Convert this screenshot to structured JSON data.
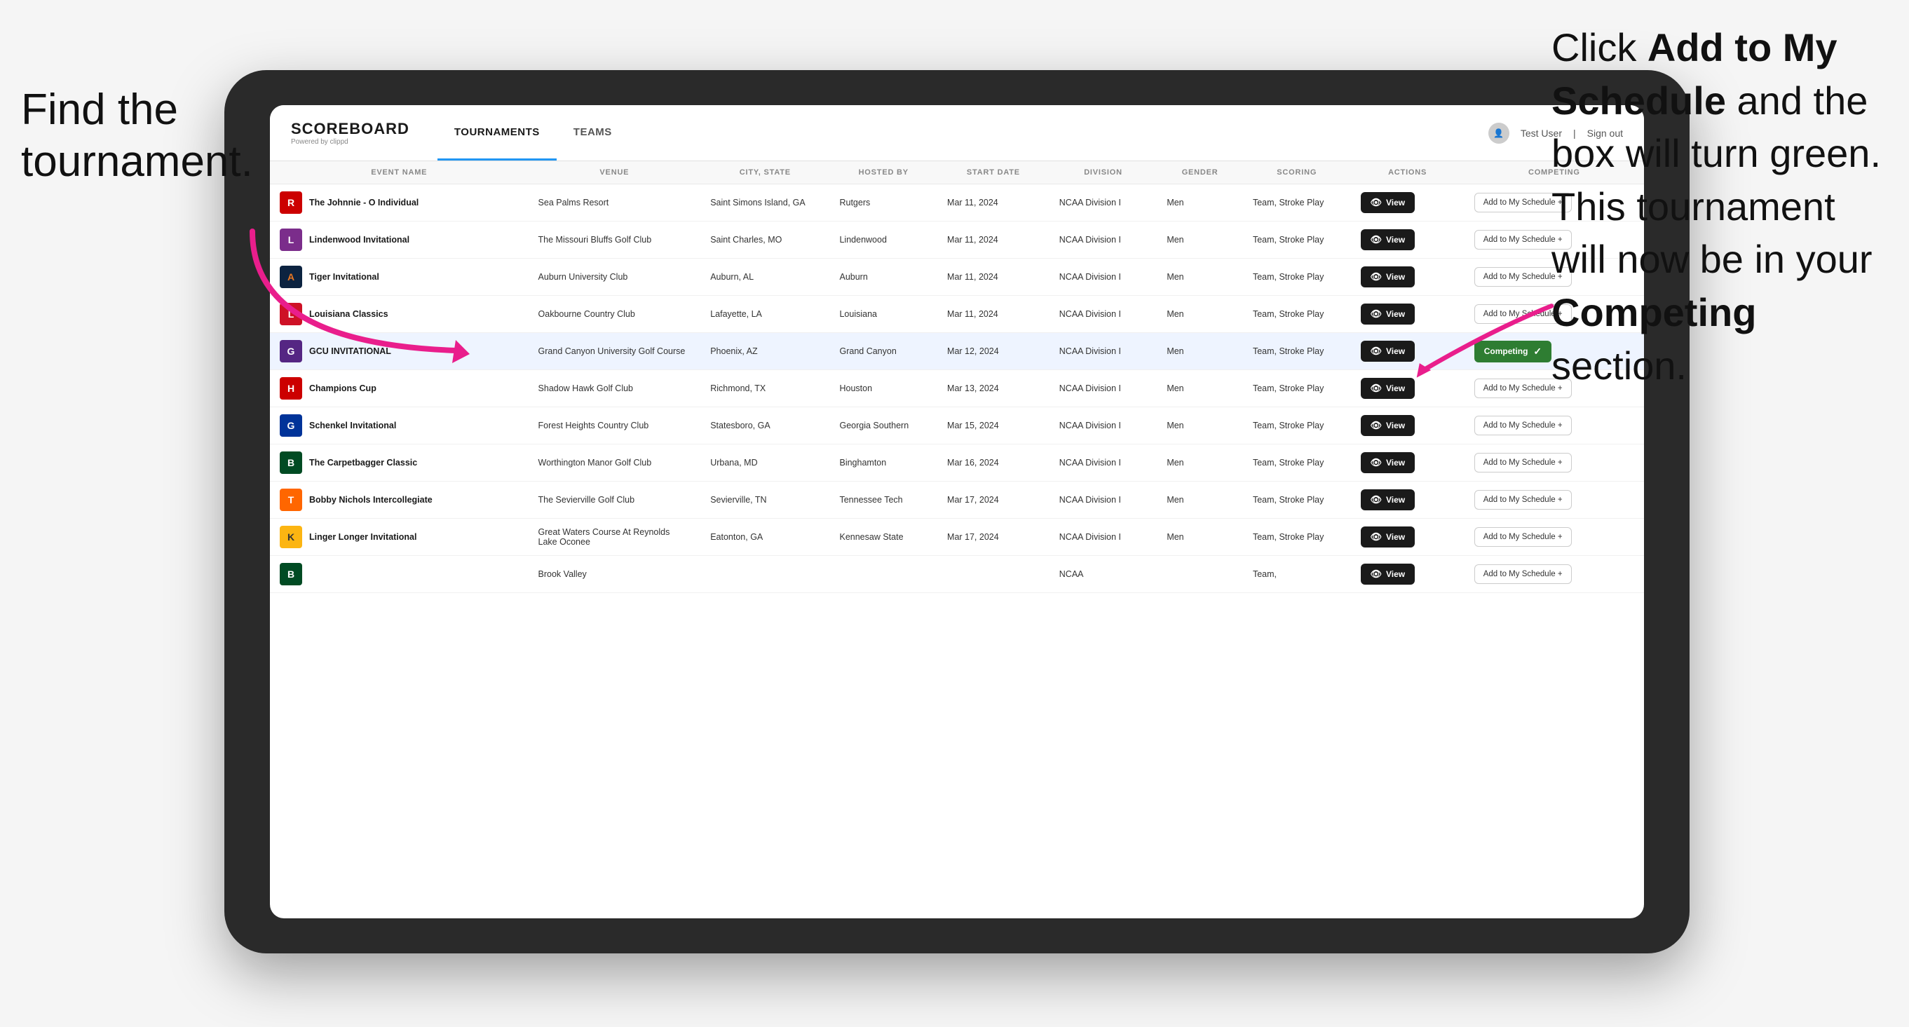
{
  "annotations": {
    "left": "Find the tournament.",
    "right_line1": "Click ",
    "right_bold1": "Add to My Schedule",
    "right_line2": " and the box will turn green. This tournament will now be in your ",
    "right_bold2": "Competing",
    "right_line3": " section."
  },
  "header": {
    "logo_main": "SCOREBOARD",
    "logo_sub": "Powered by clippd",
    "nav_tabs": [
      {
        "label": "TOURNAMENTS",
        "active": true
      },
      {
        "label": "TEAMS",
        "active": false
      }
    ],
    "user_label": "Test User",
    "sign_out": "Sign out"
  },
  "table": {
    "columns": [
      {
        "key": "event",
        "label": "EVENT NAME"
      },
      {
        "key": "venue",
        "label": "VENUE"
      },
      {
        "key": "city",
        "label": "CITY, STATE"
      },
      {
        "key": "hosted",
        "label": "HOSTED BY"
      },
      {
        "key": "date",
        "label": "START DATE"
      },
      {
        "key": "division",
        "label": "DIVISION"
      },
      {
        "key": "gender",
        "label": "GENDER"
      },
      {
        "key": "scoring",
        "label": "SCORING"
      },
      {
        "key": "actions",
        "label": "ACTIONS"
      },
      {
        "key": "competing",
        "label": "COMPETING"
      }
    ],
    "rows": [
      {
        "id": 1,
        "logo_letter": "R",
        "logo_class": "logo-rutgers",
        "event": "The Johnnie - O Individual",
        "venue": "Sea Palms Resort",
        "city": "Saint Simons Island, GA",
        "hosted": "Rutgers",
        "date": "Mar 11, 2024",
        "division": "NCAA Division I",
        "gender": "Men",
        "scoring": "Team, Stroke Play",
        "competing_status": "add",
        "competing_label": "Add to My Schedule +"
      },
      {
        "id": 2,
        "logo_letter": "L",
        "logo_class": "logo-lindenwood",
        "event": "Lindenwood Invitational",
        "venue": "The Missouri Bluffs Golf Club",
        "city": "Saint Charles, MO",
        "hosted": "Lindenwood",
        "date": "Mar 11, 2024",
        "division": "NCAA Division I",
        "gender": "Men",
        "scoring": "Team, Stroke Play",
        "competing_status": "add",
        "competing_label": "Add to My Schedule +"
      },
      {
        "id": 3,
        "logo_letter": "A",
        "logo_class": "logo-auburn",
        "event": "Tiger Invitational",
        "venue": "Auburn University Club",
        "city": "Auburn, AL",
        "hosted": "Auburn",
        "date": "Mar 11, 2024",
        "division": "NCAA Division I",
        "gender": "Men",
        "scoring": "Team, Stroke Play",
        "competing_status": "add",
        "competing_label": "Add to My Schedule +"
      },
      {
        "id": 4,
        "logo_letter": "L",
        "logo_class": "logo-louisiana",
        "event": "Louisiana Classics",
        "venue": "Oakbourne Country Club",
        "city": "Lafayette, LA",
        "hosted": "Louisiana",
        "date": "Mar 11, 2024",
        "division": "NCAA Division I",
        "gender": "Men",
        "scoring": "Team, Stroke Play",
        "competing_status": "add",
        "competing_label": "Add to My Schedule +"
      },
      {
        "id": 5,
        "logo_letter": "G",
        "logo_class": "logo-gcu",
        "event": "GCU INVITATIONAL",
        "venue": "Grand Canyon University Golf Course",
        "city": "Phoenix, AZ",
        "hosted": "Grand Canyon",
        "date": "Mar 12, 2024",
        "division": "NCAA Division I",
        "gender": "Men",
        "scoring": "Team, Stroke Play",
        "competing_status": "competing",
        "competing_label": "Competing",
        "highlighted": true
      },
      {
        "id": 6,
        "logo_letter": "H",
        "logo_class": "logo-houston",
        "event": "Champions Cup",
        "venue": "Shadow Hawk Golf Club",
        "city": "Richmond, TX",
        "hosted": "Houston",
        "date": "Mar 13, 2024",
        "division": "NCAA Division I",
        "gender": "Men",
        "scoring": "Team, Stroke Play",
        "competing_status": "add",
        "competing_label": "Add to My Schedule +"
      },
      {
        "id": 7,
        "logo_letter": "G",
        "logo_class": "logo-georgia",
        "event": "Schenkel Invitational",
        "venue": "Forest Heights Country Club",
        "city": "Statesboro, GA",
        "hosted": "Georgia Southern",
        "date": "Mar 15, 2024",
        "division": "NCAA Division I",
        "gender": "Men",
        "scoring": "Team, Stroke Play",
        "competing_status": "add",
        "competing_label": "Add to My Schedule +"
      },
      {
        "id": 8,
        "logo_letter": "B",
        "logo_class": "logo-binghamton",
        "event": "The Carpetbagger Classic",
        "venue": "Worthington Manor Golf Club",
        "city": "Urbana, MD",
        "hosted": "Binghamton",
        "date": "Mar 16, 2024",
        "division": "NCAA Division I",
        "gender": "Men",
        "scoring": "Team, Stroke Play",
        "competing_status": "add",
        "competing_label": "Add to My Schedule +"
      },
      {
        "id": 9,
        "logo_letter": "T",
        "logo_class": "logo-tennessee",
        "event": "Bobby Nichols Intercollegiate",
        "venue": "The Sevierville Golf Club",
        "city": "Sevierville, TN",
        "hosted": "Tennessee Tech",
        "date": "Mar 17, 2024",
        "division": "NCAA Division I",
        "gender": "Men",
        "scoring": "Team, Stroke Play",
        "competing_status": "add",
        "competing_label": "Add to My Schedule +"
      },
      {
        "id": 10,
        "logo_letter": "K",
        "logo_class": "logo-kennesaw",
        "event": "Linger Longer Invitational",
        "venue": "Great Waters Course At Reynolds Lake Oconee",
        "city": "Eatonton, GA",
        "hosted": "Kennesaw State",
        "date": "Mar 17, 2024",
        "division": "NCAA Division I",
        "gender": "Men",
        "scoring": "Team, Stroke Play",
        "competing_status": "add",
        "competing_label": "Add to My Schedule +"
      },
      {
        "id": 11,
        "logo_letter": "B",
        "logo_class": "logo-binghamton",
        "event": "",
        "venue": "Brook Valley",
        "city": "",
        "hosted": "",
        "date": "",
        "division": "NCAA",
        "gender": "",
        "scoring": "Team,",
        "competing_status": "add",
        "competing_label": "Add to My Schedule +"
      }
    ]
  },
  "buttons": {
    "view": "View",
    "add_to_schedule": "Add to My Schedule +",
    "competing": "Competing"
  }
}
